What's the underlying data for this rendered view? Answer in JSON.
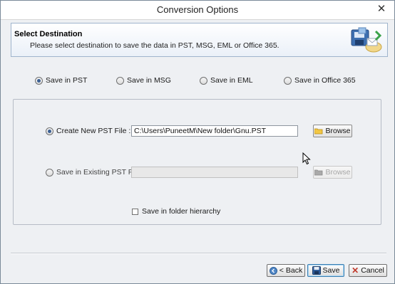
{
  "window": {
    "title": "Conversion Options",
    "close_glyph": "✕"
  },
  "header": {
    "title": "Select Destination",
    "subtitle": "Please select destination to save the data in PST, MSG, EML or Office 365.",
    "icon": "save-destination-icon"
  },
  "destination_options": [
    {
      "label": "Save in PST",
      "selected": true
    },
    {
      "label": "Save in MSG",
      "selected": false
    },
    {
      "label": "Save in EML",
      "selected": false
    },
    {
      "label": "Save in Office 365",
      "selected": false
    }
  ],
  "pst_panel": {
    "create_new": {
      "label": "Create New PST File :",
      "selected": true,
      "path_value": "C:\\Users\\PuneetM\\New folder\\Gnu.PST",
      "browse_label": "Browse"
    },
    "existing": {
      "label": "Save in Existing PST File :",
      "selected": false,
      "path_value": "",
      "browse_label": "Browse",
      "enabled": false
    },
    "folder_hierarchy": {
      "label": "Save in folder hierarchy",
      "checked": false
    }
  },
  "footer": {
    "back_label": "< Back",
    "save_label": "Save",
    "cancel_label": "Cancel"
  },
  "colors": {
    "radio_dot": "#3a5f93",
    "header_border": "#9fb4cc",
    "cancel_x": "#c0392b"
  }
}
